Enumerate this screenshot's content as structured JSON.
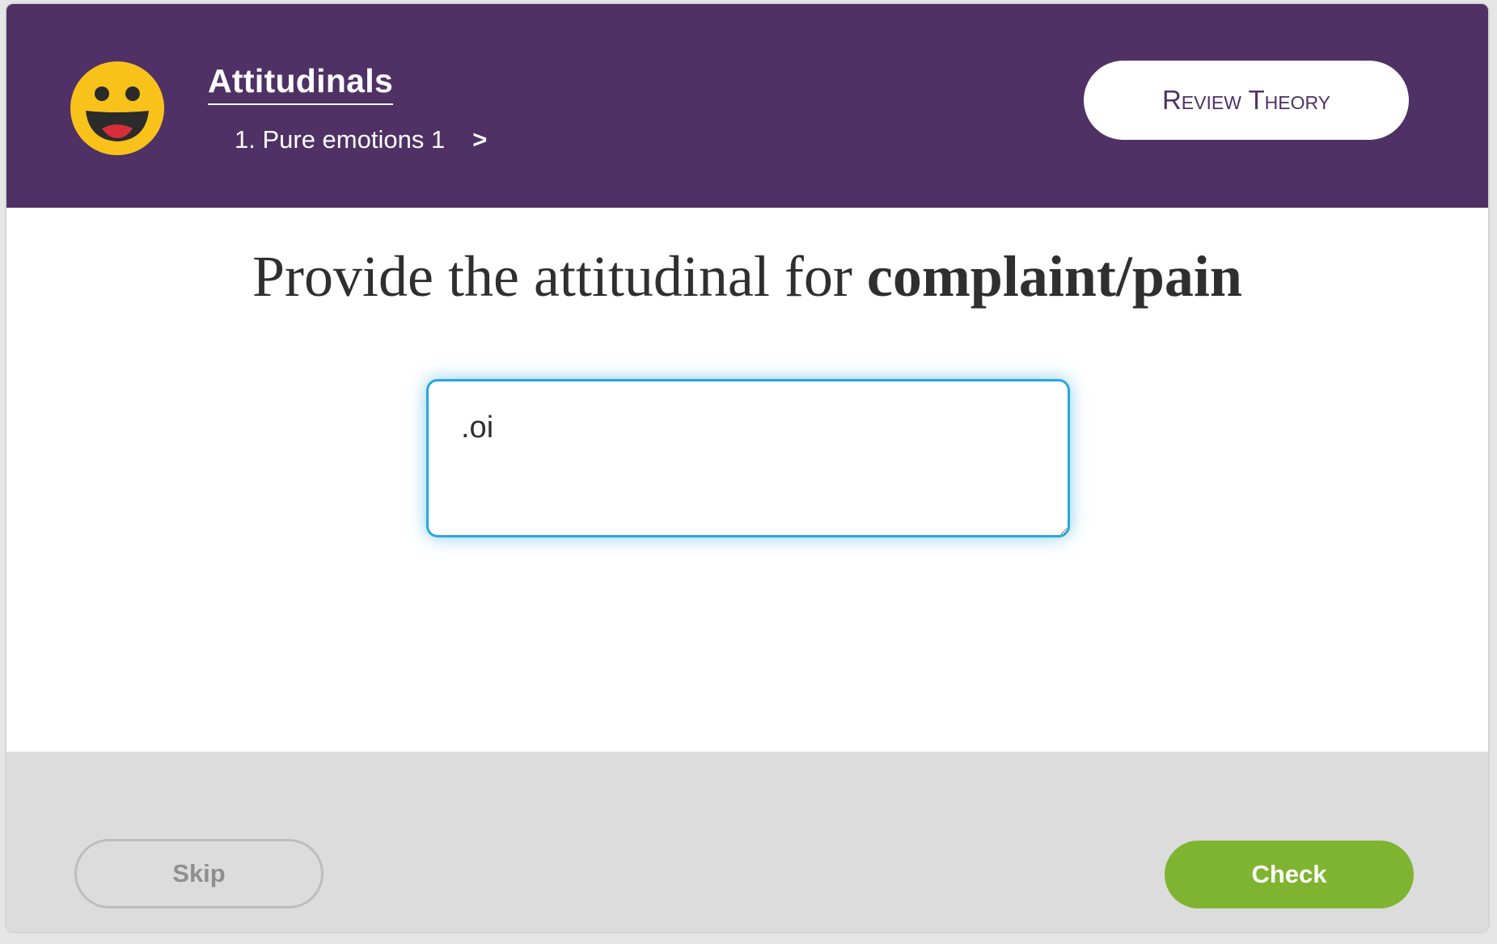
{
  "header": {
    "icon": "grinning-face-icon",
    "lesson_title": "Attitudinals",
    "breadcrumb": "1. Pure emotions 1",
    "breadcrumb_chevron": ">",
    "review_button": "Review Theory"
  },
  "question": {
    "prefix": "Provide the attitudinal for ",
    "term": "complaint/pain"
  },
  "answer": {
    "value": ".oi"
  },
  "footer": {
    "skip_label": "Skip",
    "check_label": "Check"
  },
  "colors": {
    "header_bg": "#503165",
    "accent_blue": "#2aa6e0",
    "check_green": "#7fb431",
    "emoji_yellow": "#f9c21b"
  }
}
